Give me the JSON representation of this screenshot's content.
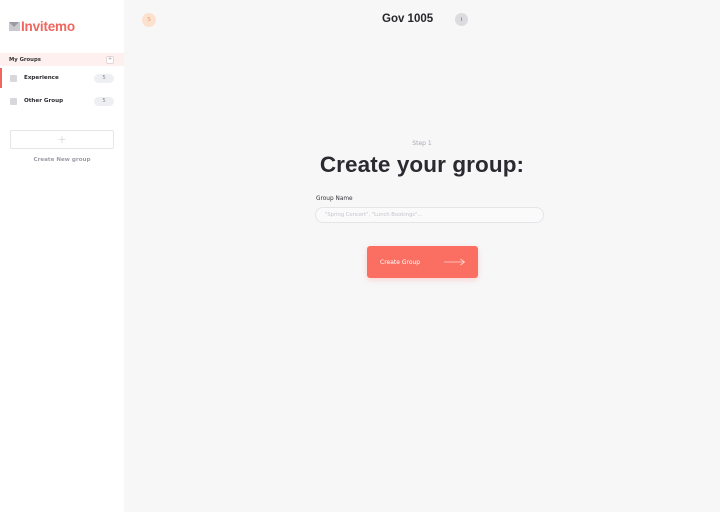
{
  "app": {
    "name": "Invitemo"
  },
  "sidebar": {
    "section_title": "My Groups",
    "section_add_icon": "+",
    "groups": [
      {
        "name": "Experience",
        "count": "5",
        "active": true
      },
      {
        "name": "Other Group",
        "count": "5",
        "active": false
      }
    ],
    "new_group_icon": "+",
    "new_group_label": "Create New group"
  },
  "topbar": {
    "avatar_initial": "S",
    "title": "Gov 1005",
    "info_icon": "i"
  },
  "main": {
    "step": "Step 1",
    "heading": "Create your group:",
    "field_label": "Group Name",
    "field_placeholder": "\"Spring Concert\", \"Lunch Bookings\"...",
    "field_value": "",
    "button_label": "Create Group",
    "button_icon": "arrow-right-icon"
  },
  "colors": {
    "accent": "#fb6f62",
    "brand": "#f0655c",
    "sidebar_bg": "#ffffff",
    "page_bg": "#f7f7f8"
  }
}
